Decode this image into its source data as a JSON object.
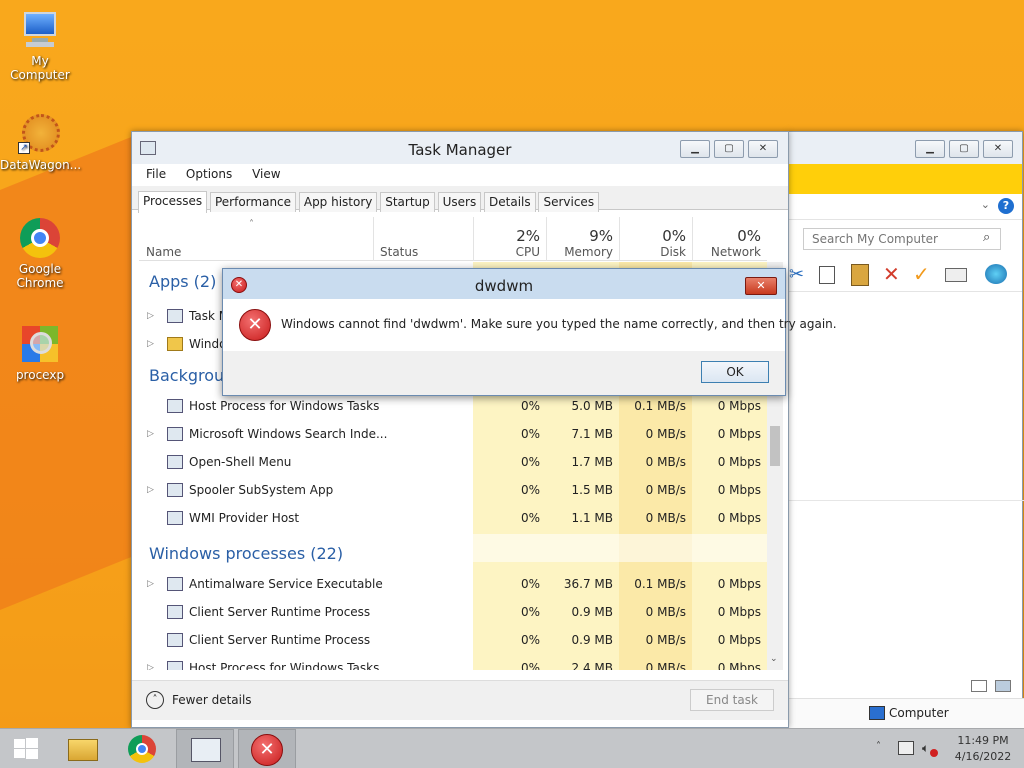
{
  "desktop": {
    "icons": [
      {
        "label": "My Computer",
        "icon": "computer-icon"
      },
      {
        "label": "DataWagon...",
        "icon": "datawagon-icon"
      },
      {
        "label": "Google Chrome",
        "icon": "chrome-icon"
      },
      {
        "label": "procexp",
        "icon": "procexp-icon"
      }
    ]
  },
  "task_manager": {
    "title": "Task Manager",
    "menu": [
      "File",
      "Options",
      "View"
    ],
    "tabs": [
      "Processes",
      "Performance",
      "App history",
      "Startup",
      "Users",
      "Details",
      "Services"
    ],
    "active_tab": "Processes",
    "columns": {
      "name": "Name",
      "status": "Status",
      "cpu": {
        "pct": "2%",
        "label": "CPU"
      },
      "memory": {
        "pct": "9%",
        "label": "Memory"
      },
      "disk": {
        "pct": "0%",
        "label": "Disk"
      },
      "network": {
        "pct": "0%",
        "label": "Network"
      }
    },
    "groups": {
      "apps": "Apps (2)",
      "background": "Backgroun",
      "windows": "Windows processes (22)"
    },
    "app_rows": [
      "Task M",
      "Windo"
    ],
    "background_rows": [
      {
        "name": "Host Process for Windows Tasks",
        "cpu": "0%",
        "memory": "5.0 MB",
        "disk": "0.1 MB/s",
        "network": "0 Mbps",
        "expand": false
      },
      {
        "name": "Microsoft Windows Search Inde...",
        "cpu": "0%",
        "memory": "7.1 MB",
        "disk": "0 MB/s",
        "network": "0 Mbps",
        "expand": true
      },
      {
        "name": "Open-Shell Menu",
        "cpu": "0%",
        "memory": "1.7 MB",
        "disk": "0 MB/s",
        "network": "0 Mbps",
        "expand": false
      },
      {
        "name": "Spooler SubSystem App",
        "cpu": "0%",
        "memory": "1.5 MB",
        "disk": "0 MB/s",
        "network": "0 Mbps",
        "expand": true
      },
      {
        "name": "WMI Provider Host",
        "cpu": "0%",
        "memory": "1.1 MB",
        "disk": "0 MB/s",
        "network": "0 Mbps",
        "expand": false
      }
    ],
    "windows_rows": [
      {
        "name": "Antimalware Service Executable",
        "cpu": "0%",
        "memory": "36.7 MB",
        "disk": "0.1 MB/s",
        "network": "0 Mbps",
        "expand": true
      },
      {
        "name": "Client Server Runtime Process",
        "cpu": "0%",
        "memory": "0.9 MB",
        "disk": "0 MB/s",
        "network": "0 Mbps",
        "expand": false
      },
      {
        "name": "Client Server Runtime Process",
        "cpu": "0%",
        "memory": "0.9 MB",
        "disk": "0 MB/s",
        "network": "0 Mbps",
        "expand": false
      },
      {
        "name": "Host Process for Windows Tasks",
        "cpu": "0%",
        "memory": "2.4 MB",
        "disk": "0 MB/s",
        "network": "0 Mbps",
        "expand": true
      }
    ],
    "fewer_details": "Fewer details",
    "end_task": "End task"
  },
  "explorer": {
    "search_placeholder": "Search My Computer",
    "status_item": "Computer"
  },
  "dialog": {
    "title": "dwdwm",
    "message": "Windows cannot find 'dwdwm'. Make sure you typed the name correctly, and then try again.",
    "ok": "OK"
  },
  "taskbar": {
    "time": "11:49 PM",
    "date": "4/16/2022"
  },
  "colors": {
    "desktop": "#f7a21a",
    "group_heading": "#2a5fa6",
    "error": "#c81b1b",
    "column_highlight": "#fdf4c3"
  }
}
